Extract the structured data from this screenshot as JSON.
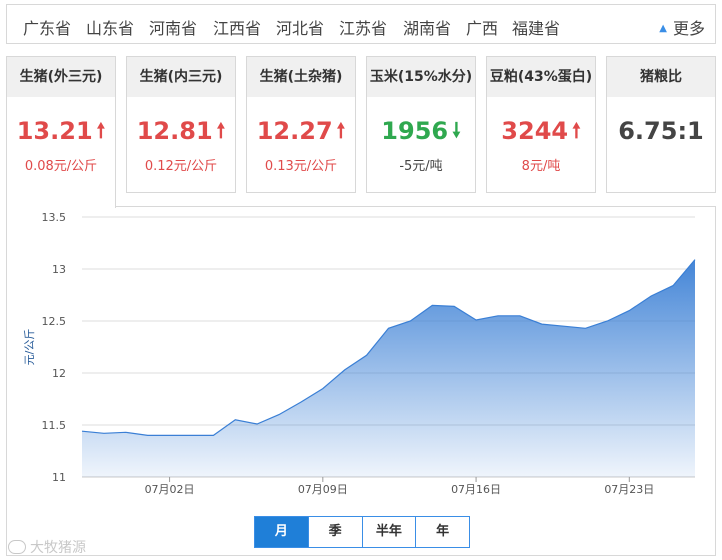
{
  "regions": [
    "广东省",
    "山东省",
    "河南省",
    "江西省",
    "河北省",
    "江苏省",
    "湖南省",
    "广西",
    "福建省"
  ],
  "more_label": "更多",
  "cards": [
    {
      "title": "生猪(外三元)",
      "price": "13.21",
      "change": "0.08元/公斤",
      "trend": "up"
    },
    {
      "title": "生猪(内三元)",
      "price": "12.81",
      "change": "0.12元/公斤",
      "trend": "up"
    },
    {
      "title": "生猪(土杂猪)",
      "price": "12.27",
      "change": "0.13元/公斤",
      "trend": "up"
    },
    {
      "title": "玉米(15%水分)",
      "price": "1956",
      "change": "-5元/吨",
      "trend": "down"
    },
    {
      "title": "豆粕(43%蛋白)",
      "price": "3244",
      "change": "8元/吨",
      "trend": "up"
    },
    {
      "title": "猪粮比",
      "price": "6.75:1",
      "change": "",
      "trend": "neutral"
    }
  ],
  "colors": {
    "up": "#e04a4a",
    "down": "#2fa84f",
    "accent": "#1f7fd8",
    "line": "#3a7fd5"
  },
  "icons": {
    "up": "arrow-up-icon",
    "down": "arrow-down-icon",
    "more": "triangle-up-icon"
  },
  "chart_data": {
    "type": "area",
    "ylabel": "元/公斤",
    "ylim": [
      11,
      13.5
    ],
    "yticks": [
      11,
      11.5,
      12,
      12.5,
      13,
      13.5
    ],
    "ytick_labels": [
      "11",
      "11.5",
      "12",
      "12.5",
      "13",
      "13.5"
    ],
    "xticks": [
      {
        "day": 2,
        "label": "07月02日"
      },
      {
        "day": 9,
        "label": "07月09日"
      },
      {
        "day": 16,
        "label": "07月16日"
      },
      {
        "day": 23,
        "label": "07月23日"
      }
    ],
    "grid": true,
    "x": [
      -2,
      -1,
      0,
      1,
      2,
      3,
      4,
      5,
      6,
      7,
      8,
      9,
      10,
      11,
      12,
      13,
      14,
      15,
      16,
      17,
      18,
      19,
      20,
      21,
      22,
      23,
      24,
      25,
      26
    ],
    "values": [
      11.44,
      11.42,
      11.43,
      11.4,
      11.4,
      11.4,
      11.4,
      11.55,
      11.51,
      11.6,
      11.72,
      11.85,
      12.03,
      12.17,
      12.43,
      12.5,
      12.65,
      12.64,
      12.51,
      12.55,
      12.55,
      12.47,
      12.45,
      12.43,
      12.5,
      12.6,
      12.74,
      12.84,
      13.09,
      13.12,
      13.21
    ]
  },
  "periods": [
    {
      "label": "月",
      "active": true
    },
    {
      "label": "季",
      "active": false
    },
    {
      "label": "半年",
      "active": false
    },
    {
      "label": "年",
      "active": false
    }
  ],
  "watermark": "大牧猪源"
}
